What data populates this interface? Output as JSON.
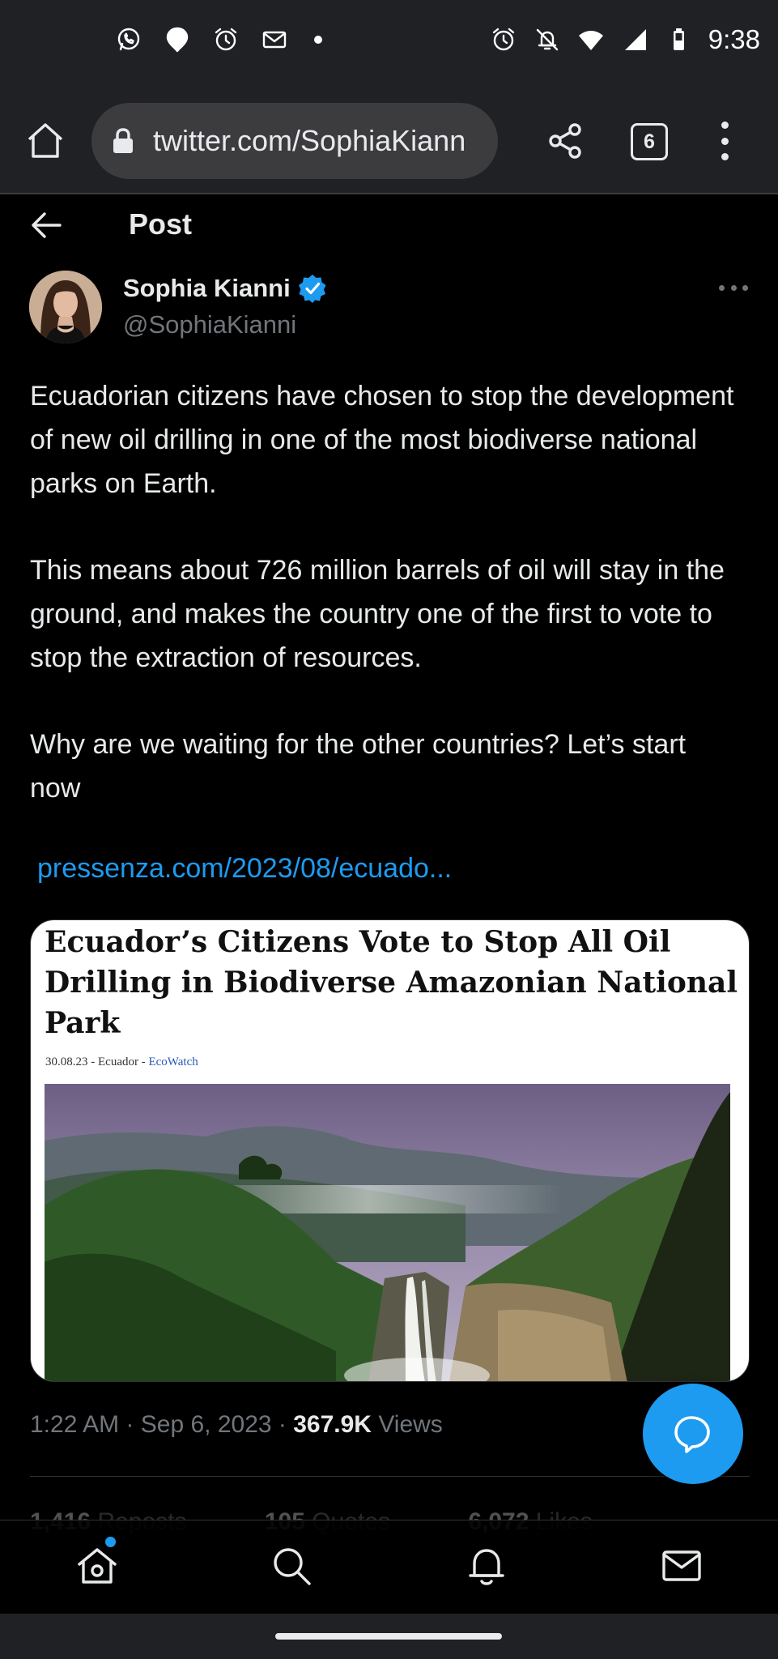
{
  "status_bar": {
    "time": "9:38",
    "left_icons": [
      "whatsapp-icon",
      "location-icon",
      "alarm-icon",
      "mail-icon"
    ],
    "right_icons": [
      "alarm-icon",
      "notifications-off-icon",
      "wifi-icon",
      "signal-icon",
      "battery-icon"
    ]
  },
  "browser": {
    "url": "twitter.com/SophiaKiann",
    "tab_count": "6"
  },
  "header": {
    "title": "Post"
  },
  "author": {
    "name": "Sophia Kianni",
    "handle": "@SophiaKianni"
  },
  "tweet": {
    "paragraph_1": "Ecuadorian citizens have chosen to stop the development of new oil drilling in one of the most biodiverse national parks on Earth.",
    "paragraph_2": "This means about 726 million barrels of oil will stay in the ground, and makes the country one of the first to vote to stop the extraction of resources.",
    "paragraph_3": "Why are we waiting for the other countries? Let’s start now",
    "link": "pressenza.com/2023/08/ecuado..."
  },
  "card": {
    "headline": "Ecuador’s Citizens Vote to Stop All Oil Drilling in Biodiverse Amazonian National Park",
    "meta_prefix": "30.08.23 - Ecuador - ",
    "meta_source": "EcoWatch"
  },
  "meta": {
    "time": "1:22 AM",
    "date": "Sep 6, 2023",
    "views_count": "367.9K",
    "views_label": "Views"
  },
  "stats": {
    "reposts_count": "1,416",
    "reposts_label": "Reposts",
    "quotes_count": "105",
    "quotes_label": "Quotes",
    "likes_count": "6,072",
    "likes_label": "Likes"
  },
  "colors": {
    "accent": "#1d9bf0",
    "background": "#000000",
    "secondary_text": "#71767b"
  }
}
